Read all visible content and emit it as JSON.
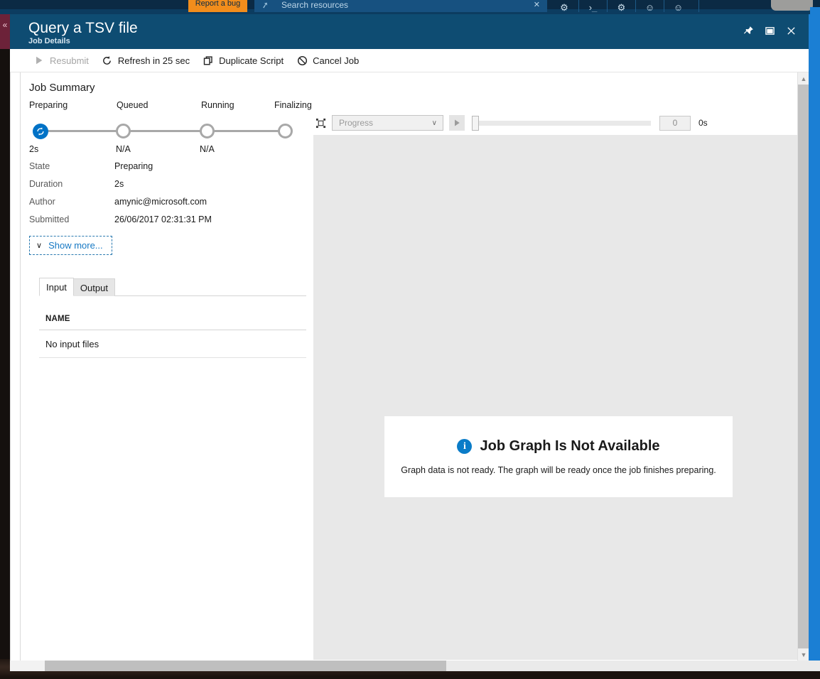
{
  "portal": {
    "report_bug_label": "Report a bug",
    "search_placeholder": "Search resources",
    "search_icon": "search-icon",
    "search_clear_icon": "clear-icon",
    "topbar_icons": [
      {
        "name": "notifications-icon",
        "glyph": "⚙"
      },
      {
        "name": "cloud-shell-icon",
        "glyph": "⌫"
      },
      {
        "name": "settings-gear-icon",
        "glyph": "⚙"
      },
      {
        "name": "help-icon",
        "glyph": "○"
      },
      {
        "name": "feedback-icon",
        "glyph": "☺"
      }
    ]
  },
  "blade": {
    "collapse_glyph": "«",
    "title": "Query a TSV file",
    "subtitle": "Job Details",
    "header_actions": [
      {
        "name": "pin-blade-button",
        "glyph": "ὌC",
        "aria": "Pin blade"
      },
      {
        "name": "maximize-blade-button",
        "glyph": "□",
        "aria": "Maximize"
      },
      {
        "name": "close-blade-button",
        "glyph": "✕",
        "aria": "Close"
      }
    ]
  },
  "commandbar": {
    "items": [
      {
        "label": "Resubmit",
        "icon": "play-triangle-icon",
        "disabled": true
      },
      {
        "label": "Refresh in 25 sec",
        "icon": "refresh-icon",
        "disabled": false
      },
      {
        "label": "Duplicate Script",
        "icon": "duplicate-icon",
        "disabled": false
      },
      {
        "label": "Cancel Job",
        "icon": "cancel-circle-slash-icon",
        "disabled": false
      }
    ]
  },
  "summary": {
    "title": "Job Summary",
    "steps": [
      {
        "label": "Preparing",
        "time": "2s",
        "state": "active"
      },
      {
        "label": "Queued",
        "time": "N/A",
        "state": "pending"
      },
      {
        "label": "Running",
        "time": "N/A",
        "state": "pending"
      },
      {
        "label": "Finalizing",
        "time": "",
        "state": "pending"
      }
    ],
    "details": [
      {
        "key": "State",
        "value": "Preparing"
      },
      {
        "key": "Duration",
        "value": "2s"
      },
      {
        "key": "Author",
        "value": "amynic@microsoft.com"
      },
      {
        "key": "Submitted",
        "value": "26/06/2017 02:31:31 PM"
      }
    ],
    "show_more_label": "Show more...",
    "show_more_chevron": "∨"
  },
  "filetabs": {
    "tabs": [
      {
        "label": "Input",
        "active": true
      },
      {
        "label": "Output",
        "active": false
      }
    ],
    "column_header": "NAME",
    "empty_row": "No input files"
  },
  "graph_toolbar": {
    "fit_icon": "fit-to-screen-icon",
    "select_value": "Progress",
    "select_caret": "∨",
    "play_icon": "play-icon",
    "slider_position": 0,
    "step_number": "0",
    "elapsed": "0s"
  },
  "graph": {
    "message_icon": "info-icon",
    "message_icon_glyph": "i",
    "message_title": "Job Graph Is Not Available",
    "message_body": "Graph data is not ready. The graph will be ready once the job finishes preparing."
  },
  "scroll": {
    "up_arrow": "▲",
    "down_arrow": "▼"
  },
  "colors": {
    "blade_header": "#0e4c72",
    "accent_blue": "#0072c6",
    "portal_rail": "#1b7fd4",
    "report_bug_orange": "#f28d1c",
    "collapse_tab": "#6c2239",
    "graph_pane": "#e8e8e8",
    "info_icon": "#0a7cc8"
  }
}
